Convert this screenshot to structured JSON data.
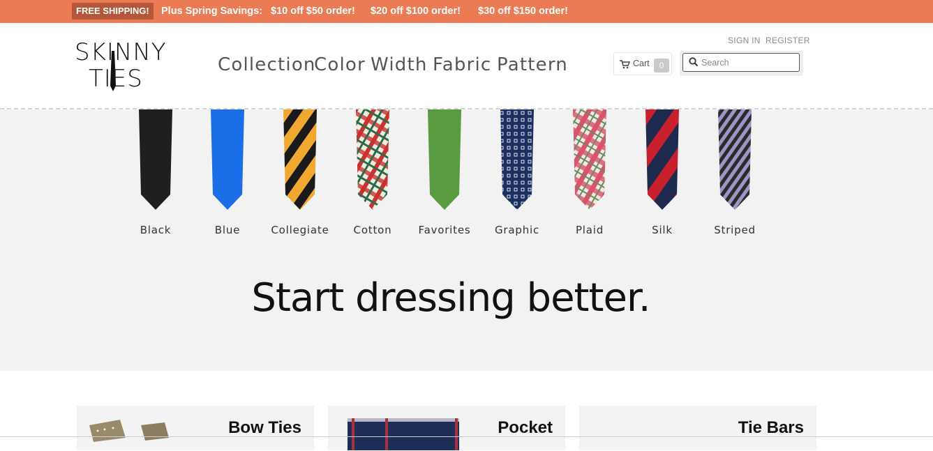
{
  "promo": {
    "badge": "FREE SHIPPING!",
    "intro": "Plus Spring Savings:",
    "offers": [
      "$10 off $50 order!",
      "$20 off $100 order!",
      "$30 off $150 order!"
    ]
  },
  "logo": {
    "line1": "SKINNY",
    "line2": "TIES"
  },
  "nav": [
    "Collection",
    "Color",
    "Width",
    "Fabric",
    "Pattern"
  ],
  "account": {
    "sign_in": "SIGN IN",
    "register": "REGISTER"
  },
  "cart": {
    "label": "Cart",
    "count": "0"
  },
  "search": {
    "placeholder": "Search"
  },
  "ties": [
    {
      "label": "Black",
      "pattern": "solid-black"
    },
    {
      "label": "Blue",
      "pattern": "solid-blue"
    },
    {
      "label": "Collegiate",
      "pattern": "stripe-gold-black"
    },
    {
      "label": "Cotton",
      "pattern": "plaid-red-green"
    },
    {
      "label": "Favorites",
      "pattern": "solid-green"
    },
    {
      "label": "Graphic",
      "pattern": "navy-squares"
    },
    {
      "label": "Plaid",
      "pattern": "plaid-pink"
    },
    {
      "label": "Silk",
      "pattern": "stripe-navy-red"
    },
    {
      "label": "Striped",
      "pattern": "stripe-lavender-black"
    }
  ],
  "hero": {
    "headline": "Start dressing better."
  },
  "categories": [
    {
      "title": "Bow Ties"
    },
    {
      "title": "Pocket"
    },
    {
      "title": "Tie Bars"
    }
  ],
  "colors": {
    "promo_bar": "#ea7b54",
    "hero_bg": "#f2f2f2"
  }
}
